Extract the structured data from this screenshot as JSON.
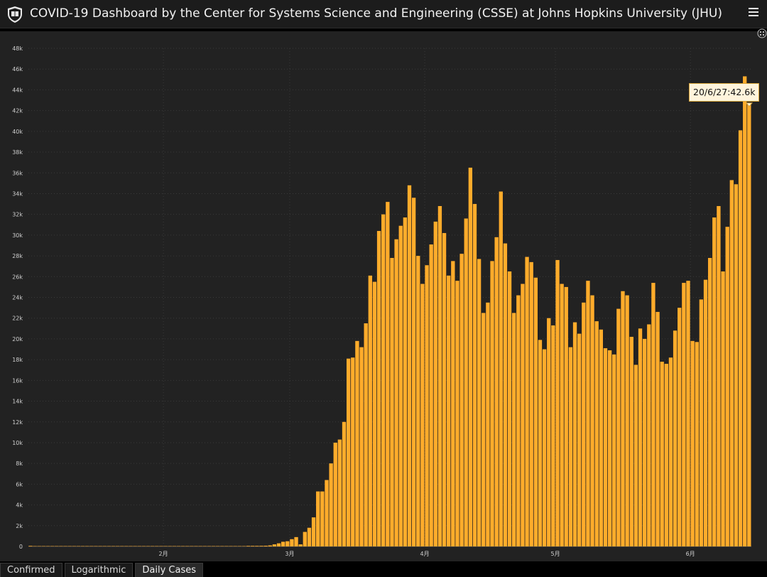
{
  "header": {
    "title": "COVID-19 Dashboard by the Center for Systems Science and Engineering (CSSE) at Johns Hopkins University (JHU)"
  },
  "icons": {
    "logo": "shield-logo-icon",
    "menu": "hamburger-menu-icon",
    "expand": "expand-icon"
  },
  "colors": {
    "bar": "#ffac2b",
    "background": "#222222",
    "grid": "#3a3a3a",
    "tooltip_bg": "#fff4dc"
  },
  "tooltip": {
    "text": "20/6/27:42.6k"
  },
  "tabs": [
    {
      "label": "Confirmed",
      "active": false
    },
    {
      "label": "Logarithmic",
      "active": false
    },
    {
      "label": "Daily Cases",
      "active": true
    }
  ],
  "chart_data": {
    "type": "bar",
    "ylim": [
      0,
      48000
    ],
    "y_ticks": [
      "0",
      "2k",
      "4k",
      "6k",
      "8k",
      "10k",
      "12k",
      "14k",
      "16k",
      "18k",
      "20k",
      "22k",
      "24k",
      "26k",
      "28k",
      "30k",
      "32k",
      "34k",
      "36k",
      "38k",
      "40k",
      "42k",
      "44k",
      "46k",
      "48k"
    ],
    "x_ticks": [
      {
        "label": "2月",
        "index": 31
      },
      {
        "label": "3月",
        "index": 60
      },
      {
        "label": "4月",
        "index": 91
      },
      {
        "label": "5月",
        "index": 121
      },
      {
        "label": "6月",
        "index": 152
      }
    ],
    "grid": true,
    "values": [
      1,
      0,
      0,
      0,
      0,
      0,
      0,
      0,
      0,
      0,
      0,
      0,
      0,
      0,
      0,
      0,
      0,
      0,
      0,
      0,
      0,
      0,
      0,
      0,
      0,
      0,
      0,
      0,
      0,
      0,
      0,
      0,
      0,
      0,
      0,
      0,
      0,
      0,
      0,
      0,
      0,
      0,
      0,
      0,
      0,
      0,
      0,
      0,
      0,
      0,
      20,
      30,
      40,
      60,
      70,
      100,
      200,
      300,
      450,
      500,
      700,
      900,
      200,
      1400,
      1800,
      2800,
      5300,
      5300,
      6400,
      8000,
      10000,
      10300,
      12000,
      18100,
      18200,
      19800,
      19200,
      21500,
      26100,
      25500,
      30400,
      32000,
      33200,
      27800,
      29600,
      30900,
      31700,
      34800,
      33600,
      28000,
      25300,
      27100,
      29100,
      31300,
      32800,
      30200,
      26100,
      27500,
      25600,
      28200,
      31600,
      36500,
      33000,
      27700,
      22500,
      23500,
      27500,
      29800,
      34200,
      29200,
      26500,
      22500,
      24200,
      25300,
      27900,
      27400,
      25900,
      19900,
      19000,
      22000,
      21300,
      27600,
      25300,
      25000,
      19200,
      21600,
      20500,
      23500,
      25600,
      24200,
      21700,
      20900,
      19100,
      18900,
      18500,
      22900,
      24600,
      24200,
      20200,
      17500,
      21000,
      20000,
      21400,
      25400,
      22600,
      17800,
      17600,
      18200,
      20800,
      23000,
      25400,
      25600,
      19800,
      19700,
      23800,
      25700,
      27800,
      31700,
      32800,
      26500,
      30800,
      35300,
      34900,
      40100,
      45300,
      42600
    ]
  }
}
